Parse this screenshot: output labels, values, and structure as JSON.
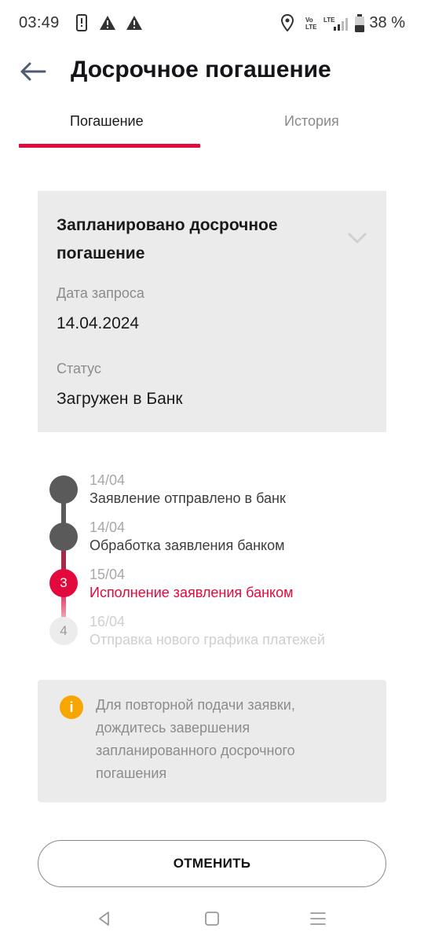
{
  "status_bar": {
    "time": "03:49",
    "battery_percent": "38 %",
    "network_volte_top": "Vo",
    "network_volte_bottom": "LTE",
    "network_lte": "LTE"
  },
  "header": {
    "title": "Досрочное погашение",
    "back_icon": "arrow-left-icon"
  },
  "tabs": [
    {
      "label": "Погашение",
      "active": true
    },
    {
      "label": "История",
      "active": false
    }
  ],
  "card": {
    "title": "Запланировано досрочное погашение",
    "request_date_label": "Дата запроса",
    "request_date": "14.04.2024",
    "status_label": "Статус",
    "status_value": "Загружен в Банк"
  },
  "timeline": [
    {
      "number": "",
      "date": "14/04",
      "text": "Заявление отправлено в банк",
      "state": "done"
    },
    {
      "number": "",
      "date": "14/04",
      "text": "Обработка заявления банком",
      "state": "done"
    },
    {
      "number": "3",
      "date": "15/04",
      "text": "Исполнение заявления банком",
      "state": "current"
    },
    {
      "number": "4",
      "date": "16/04",
      "text": "Отправка нового графика платежей",
      "state": "pending"
    }
  ],
  "notice": {
    "icon": "info-icon",
    "text": "Для повторной подачи заявки, дождитесь завершения запланированного досрочного погашения"
  },
  "actions": {
    "cancel_label": "ОТМЕНИТЬ"
  },
  "colors": {
    "accent": "#e3093c",
    "done": "#5a5a5a",
    "pending": "#e6e6e6",
    "card_bg": "#ebebeb",
    "warning": "#f7a600"
  }
}
